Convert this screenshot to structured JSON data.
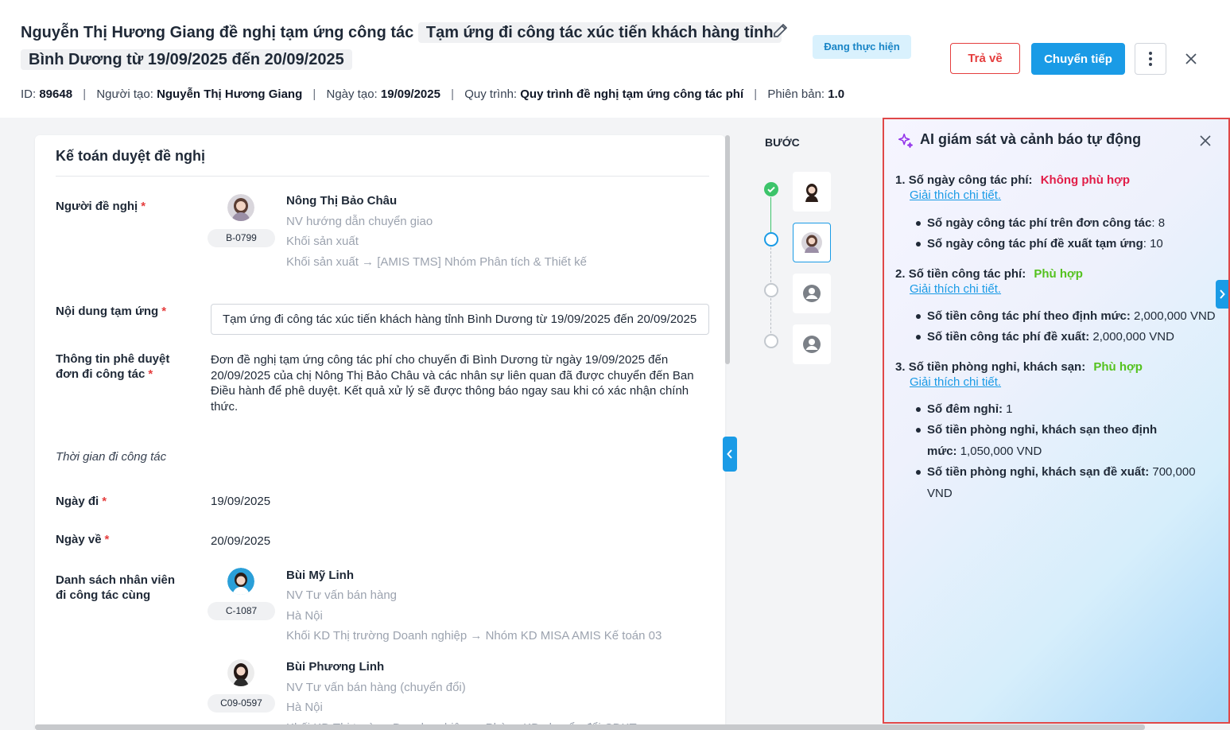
{
  "header": {
    "title_prefix": "Nguyễn Thị Hương Giang đề nghị tạm ứng công tác",
    "title_highlight": "Tạm ứng đi công tác xúc tiến khách hàng tỉnh Bình Dương từ 19/09/2025 đến 20/09/2025",
    "status": "Đang thực hiện",
    "return_label": "Trả về",
    "forward_label": "Chuyển tiếp",
    "meta": {
      "id_label": "ID:",
      "id": "89648",
      "creator_label": "Người tạo:",
      "creator": "Nguyễn Thị Hương Giang",
      "created_label": "Ngày tạo:",
      "created": "19/09/2025",
      "process_label": "Quy trình:",
      "process": "Quy trình đề nghị tạm ứng công tác phí",
      "version_label": "Phiên bản:",
      "version": "1.0",
      "separator": "|"
    }
  },
  "form": {
    "title": "Kế toán duyệt đề nghị",
    "requester_label": "Người đề nghị",
    "required_mark": "*",
    "requester": {
      "code": "B-0799",
      "name": "Nông Thị Bảo Châu",
      "position": "NV hướng dẫn chuyển giao",
      "unit": "Khối sản xuất",
      "path": "Khối sản xuất → [AMIS TMS] Nhóm Phân tích & Thiết kế"
    },
    "content_label": "Nội dung tạm ứng",
    "content_value": "Tạm ứng đi công tác xúc tiến khách hàng tỉnh Bình Dương từ 19/09/2025 đến 20/09/2025",
    "approval_label_1": "Thông tin phê duyệt",
    "approval_label_2": "đơn đi công tác",
    "approval_text": "Đơn đề nghị tạm ứng công tác phí cho chuyến đi Bình Dương từ ngày 19/09/2025 đến 20/09/2025 của chị Nông Thị Bảo Châu và các nhân sự liên quan đã được chuyển đến Ban Điều hành để phê duyệt. Kết quả xử lý sẽ được thông báo ngay sau khi có xác nhận chính thức.",
    "time_section": "Thời gian đi công tác",
    "depart_label": "Ngày đi",
    "depart": "19/09/2025",
    "return_label": "Ngày về",
    "return": "20/09/2025",
    "staff_label_1": "Danh sách nhân viên",
    "staff_label_2": "đi công tác cùng",
    "staff": [
      {
        "code": "C-1087",
        "name": "Bùi Mỹ Linh",
        "position": "NV Tư vấn bán hàng",
        "unit": "Hà Nội",
        "path": "Khối KD Thị trường Doanh nghiệp → Nhóm KD MISA AMIS Kế toán 03"
      },
      {
        "code": "C09-0597",
        "name": "Bùi Phương Linh",
        "position": "NV Tư vấn bán hàng (chuyển đổi)",
        "unit": "Hà Nội",
        "path": "Khối KD Thị trường Doanh nghiệp → Phòng KD chuyển đổi CĐKT"
      }
    ]
  },
  "steps": {
    "title": "BƯỚC"
  },
  "ai": {
    "title": "AI giám sát và cảnh báo tự động",
    "link_label": "Giải thích chi tiết.",
    "items": [
      {
        "number": "1.",
        "label": "Số ngày công tác phí:",
        "result": "Không phù hợp",
        "bullets": [
          {
            "label": "Số ngày công tác phí trên đơn công tác",
            "value": ": 8"
          },
          {
            "label": "Số ngày công tác phí đề xuất tạm ứng",
            "value": ": 10"
          }
        ]
      },
      {
        "number": "2.",
        "label": "Số tiền công tác phí:",
        "result": "Phù hợp",
        "bullets": [
          {
            "label": "Số tiền công tác phí theo định mức:",
            "value": " 2,000,000 VND"
          },
          {
            "label": "Số tiền công tác phí đề xuất:",
            "value": " 2,000,000 VND"
          }
        ]
      },
      {
        "number": "3.",
        "label": "Số tiền phòng nghỉ, khách sạn:",
        "result": "Phù hợp",
        "bullets": [
          {
            "label": "Số đêm nghỉ:",
            "value": " 1"
          },
          {
            "label": "Số tiền phòng nghỉ, khách sạn theo định mức:",
            "value": " 1,050,000 VND"
          },
          {
            "label": "Số tiền phòng nghỉ, khách sạn đề xuất:",
            "value": " 700,000 VND"
          }
        ]
      }
    ]
  },
  "colors": {
    "primary": "#1a9be6",
    "danger": "#e11d48",
    "success": "#54c21e",
    "highlight_border": "#e04848"
  }
}
